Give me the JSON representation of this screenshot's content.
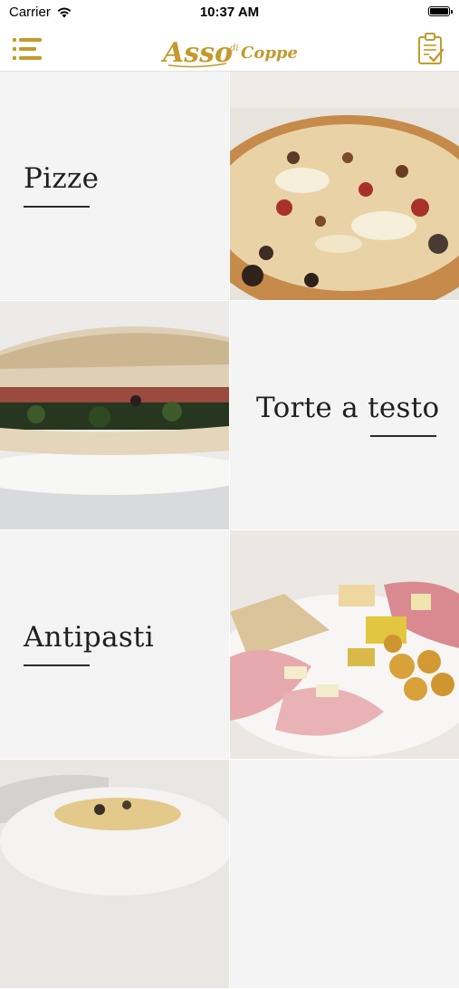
{
  "status_bar": {
    "carrier": "Carrier",
    "time": "10:37 AM",
    "battery_level": 1.0
  },
  "nav": {
    "logo_text": "Asso",
    "logo_sub": "di",
    "logo_text2": "Coppe",
    "icons": {
      "menu": "menu-icon",
      "order": "clipboard-check-icon"
    },
    "brand_color": "#c49a2c"
  },
  "categories": [
    {
      "label": "Pizze",
      "image": "pizza-photo"
    },
    {
      "label": "Torte a testo",
      "image": "torta-sandwich-photo"
    },
    {
      "label": "Antipasti",
      "image": "antipasti-platter-photo"
    },
    {
      "label": "",
      "image": "pasta-photo"
    }
  ]
}
